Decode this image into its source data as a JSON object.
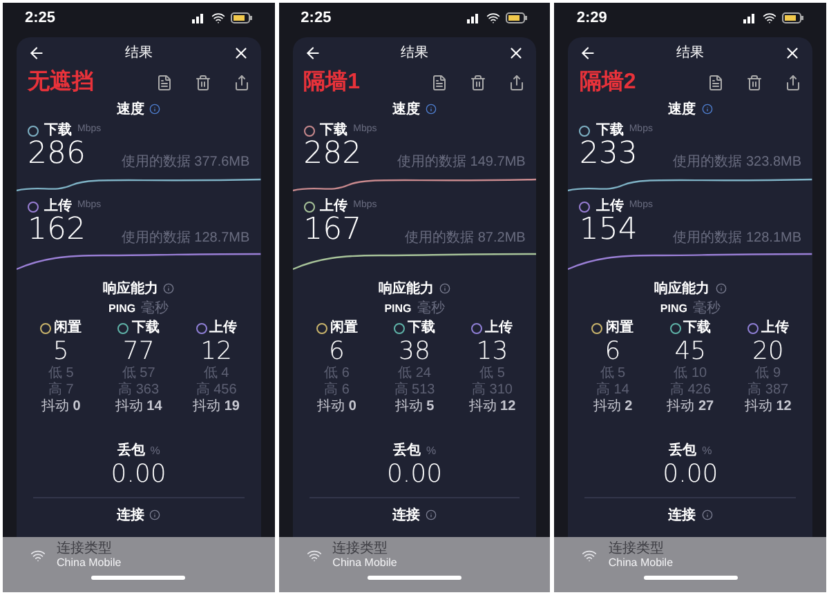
{
  "panels": [
    {
      "time": "2:25",
      "title": "结果",
      "label": "无遮挡",
      "speed": {
        "title": "速度",
        "metrics": [
          {
            "name": "下载",
            "unit": "Mbps",
            "value": "286",
            "data": "使用的数据 377.6MB",
            "color": "#7fb3c6"
          },
          {
            "name": "上传",
            "unit": "Mbps",
            "value": "162",
            "data": "使用的数据 128.7MB",
            "color": "#9a7fd6"
          }
        ]
      },
      "response": {
        "title": "响应能力",
        "ping": "PING",
        "ping_unit": "毫秒",
        "columns": [
          {
            "name": "闲置",
            "value": "5",
            "low": "低 5",
            "high": "高 7",
            "jitter": "抖动 **0**",
            "color": "#c9b46c"
          },
          {
            "name": "下载",
            "value": "77",
            "low": "低 57",
            "high": "高 363",
            "jitter": "抖动 **14**",
            "color": "#5fb3a8"
          },
          {
            "name": "上传",
            "value": "12",
            "low": "低 4",
            "high": "高 456",
            "jitter": "抖动 **19**",
            "color": "#8f7fd6"
          }
        ]
      },
      "loss": {
        "label": "丢包",
        "unit": "%",
        "value": "0.00"
      },
      "connection": {
        "title": "连接",
        "type_label": "连接类型",
        "carrier": "China Mobile"
      }
    },
    {
      "time": "2:25",
      "title": "结果",
      "label": "隔墙1",
      "speed": {
        "title": "速度",
        "metrics": [
          {
            "name": "下载",
            "unit": "Mbps",
            "value": "282",
            "data": "使用的数据 149.7MB",
            "color": "#c98a8e"
          },
          {
            "name": "上传",
            "unit": "Mbps",
            "value": "167",
            "data": "使用的数据 87.2MB",
            "color": "#a8c49a"
          }
        ]
      },
      "response": {
        "title": "响应能力",
        "ping": "PING",
        "ping_unit": "毫秒",
        "columns": [
          {
            "name": "闲置",
            "value": "6",
            "low": "低 6",
            "high": "高 6",
            "jitter": "抖动 **0**",
            "color": "#c9b46c"
          },
          {
            "name": "下载",
            "value": "38",
            "low": "低 24",
            "high": "高 513",
            "jitter": "抖动 **5**",
            "color": "#5fb3a8"
          },
          {
            "name": "上传",
            "value": "13",
            "low": "低 5",
            "high": "高 310",
            "jitter": "抖动 **12**",
            "color": "#8f7fd6"
          }
        ]
      },
      "loss": {
        "label": "丢包",
        "unit": "%",
        "value": "0.00"
      },
      "connection": {
        "title": "连接",
        "type_label": "连接类型",
        "carrier": "China Mobile"
      }
    },
    {
      "time": "2:29",
      "title": "结果",
      "label": "隔墙2",
      "speed": {
        "title": "速度",
        "metrics": [
          {
            "name": "下载",
            "unit": "Mbps",
            "value": "233",
            "data": "使用的数据 323.8MB",
            "color": "#7fb3c6"
          },
          {
            "name": "上传",
            "unit": "Mbps",
            "value": "154",
            "data": "使用的数据 128.1MB",
            "color": "#9a7fd6"
          }
        ]
      },
      "response": {
        "title": "响应能力",
        "ping": "PING",
        "ping_unit": "毫秒",
        "columns": [
          {
            "name": "闲置",
            "value": "6",
            "low": "低 5",
            "high": "高 14",
            "jitter": "抖动 **2**",
            "color": "#c9b46c"
          },
          {
            "name": "下载",
            "value": "45",
            "low": "低 10",
            "high": "高 426",
            "jitter": "抖动 **27**",
            "color": "#5fb3a8"
          },
          {
            "name": "上传",
            "value": "20",
            "low": "低 9",
            "high": "高 387",
            "jitter": "抖动 **12**",
            "color": "#8f7fd6"
          }
        ]
      },
      "loss": {
        "label": "丢包",
        "unit": "%",
        "value": "0.00"
      },
      "connection": {
        "title": "连接",
        "type_label": "连接类型",
        "carrier": "China Mobile"
      }
    }
  ]
}
